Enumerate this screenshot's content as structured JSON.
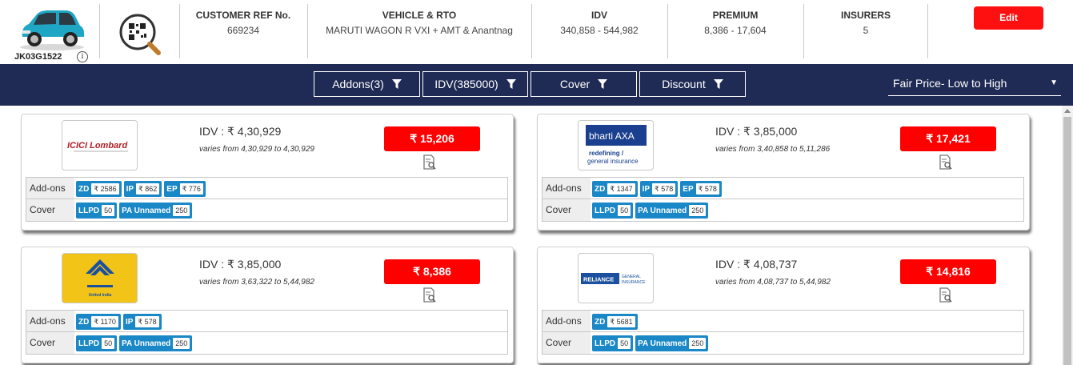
{
  "header": {
    "vehicle_reg": "JK03G1522",
    "info_glyph": "i",
    "customer_ref": {
      "label": "CUSTOMER REF No.",
      "value": "669234"
    },
    "vehicle_rto": {
      "label": "VEHICLE & RTO",
      "value": "MARUTI WAGON R VXI + AMT & Anantnag"
    },
    "idv": {
      "label": "IDV",
      "value": "340,858 - 544,982"
    },
    "premium": {
      "label": "PREMIUM",
      "value": "8,386 - 17,604"
    },
    "insurers": {
      "label": "INSURERS",
      "value": "5"
    },
    "edit_label": "Edit",
    "icons": [
      "car-icon",
      "qr-search-icon",
      "info-icon"
    ]
  },
  "filters": {
    "addons": "Addons(3)",
    "idv": "IDV(385000)",
    "cover": "Cover",
    "discount": "Discount",
    "sort_selected": "Fair Price- Low to High",
    "icons": [
      "filter-funnel-icon",
      "dropdown-caret-icon"
    ]
  },
  "cards": [
    {
      "insurer_logo": "ICICI Lombard",
      "idv_text": "IDV : ₹ 4,30,929",
      "varies_text": "varies from 4,30,929 to 4,30,929",
      "price": "₹ 15,206",
      "addons_label": "Add-ons",
      "addons": [
        {
          "code": "ZD",
          "value": "₹ 2586"
        },
        {
          "code": "IP",
          "value": "₹ 862"
        },
        {
          "code": "EP",
          "value": "₹ 776"
        }
      ],
      "cover_label": "Cover",
      "covers": [
        {
          "code": "LLPD",
          "value": "50"
        },
        {
          "code": "PA Unnamed",
          "value": "250"
        }
      ]
    },
    {
      "insurer_logo": "bharti AXA",
      "logo_sub1": "redefining /",
      "logo_sub2": "general insurance",
      "idv_text": "IDV : ₹ 3,85,000",
      "varies_text": "varies from 3,40,858 to 5,11,286",
      "price": "₹ 17,421",
      "addons_label": "Add-ons",
      "addons": [
        {
          "code": "ZD",
          "value": "₹ 1347"
        },
        {
          "code": "IP",
          "value": "₹ 578"
        },
        {
          "code": "EP",
          "value": "₹ 578"
        }
      ],
      "cover_label": "Cover",
      "covers": [
        {
          "code": "LLPD",
          "value": "50"
        },
        {
          "code": "PA Unnamed",
          "value": "250"
        }
      ]
    },
    {
      "insurer_logo": "United India",
      "idv_text": "IDV : ₹ 3,85,000",
      "varies_text": "varies from 3,63,322 to 5,44,982",
      "price": "₹ 8,386",
      "addons_label": "Add-ons",
      "addons": [
        {
          "code": "ZD",
          "value": "₹ 1170"
        },
        {
          "code": "IP",
          "value": "₹ 578"
        }
      ],
      "cover_label": "Cover",
      "covers": [
        {
          "code": "LLPD",
          "value": "50"
        },
        {
          "code": "PA Unnamed",
          "value": "250"
        }
      ]
    },
    {
      "insurer_logo": "RELIANCE",
      "logo_sub1": "GENERAL",
      "logo_sub2": "INSURANCE",
      "idv_text": "IDV : ₹ 4,08,737",
      "varies_text": "varies from 4,08,737 to 5,44,982",
      "price": "₹ 14,816",
      "addons_label": "Add-ons",
      "addons": [
        {
          "code": "ZD",
          "value": "₹ 5681"
        }
      ],
      "cover_label": "Cover",
      "covers": [
        {
          "code": "LLPD",
          "value": "50"
        },
        {
          "code": "PA Unnamed",
          "value": "250"
        }
      ]
    }
  ],
  "colors": {
    "navy": "#1f2b55",
    "price_red": "#ff0000",
    "tag_blue": "#1a87c7"
  }
}
